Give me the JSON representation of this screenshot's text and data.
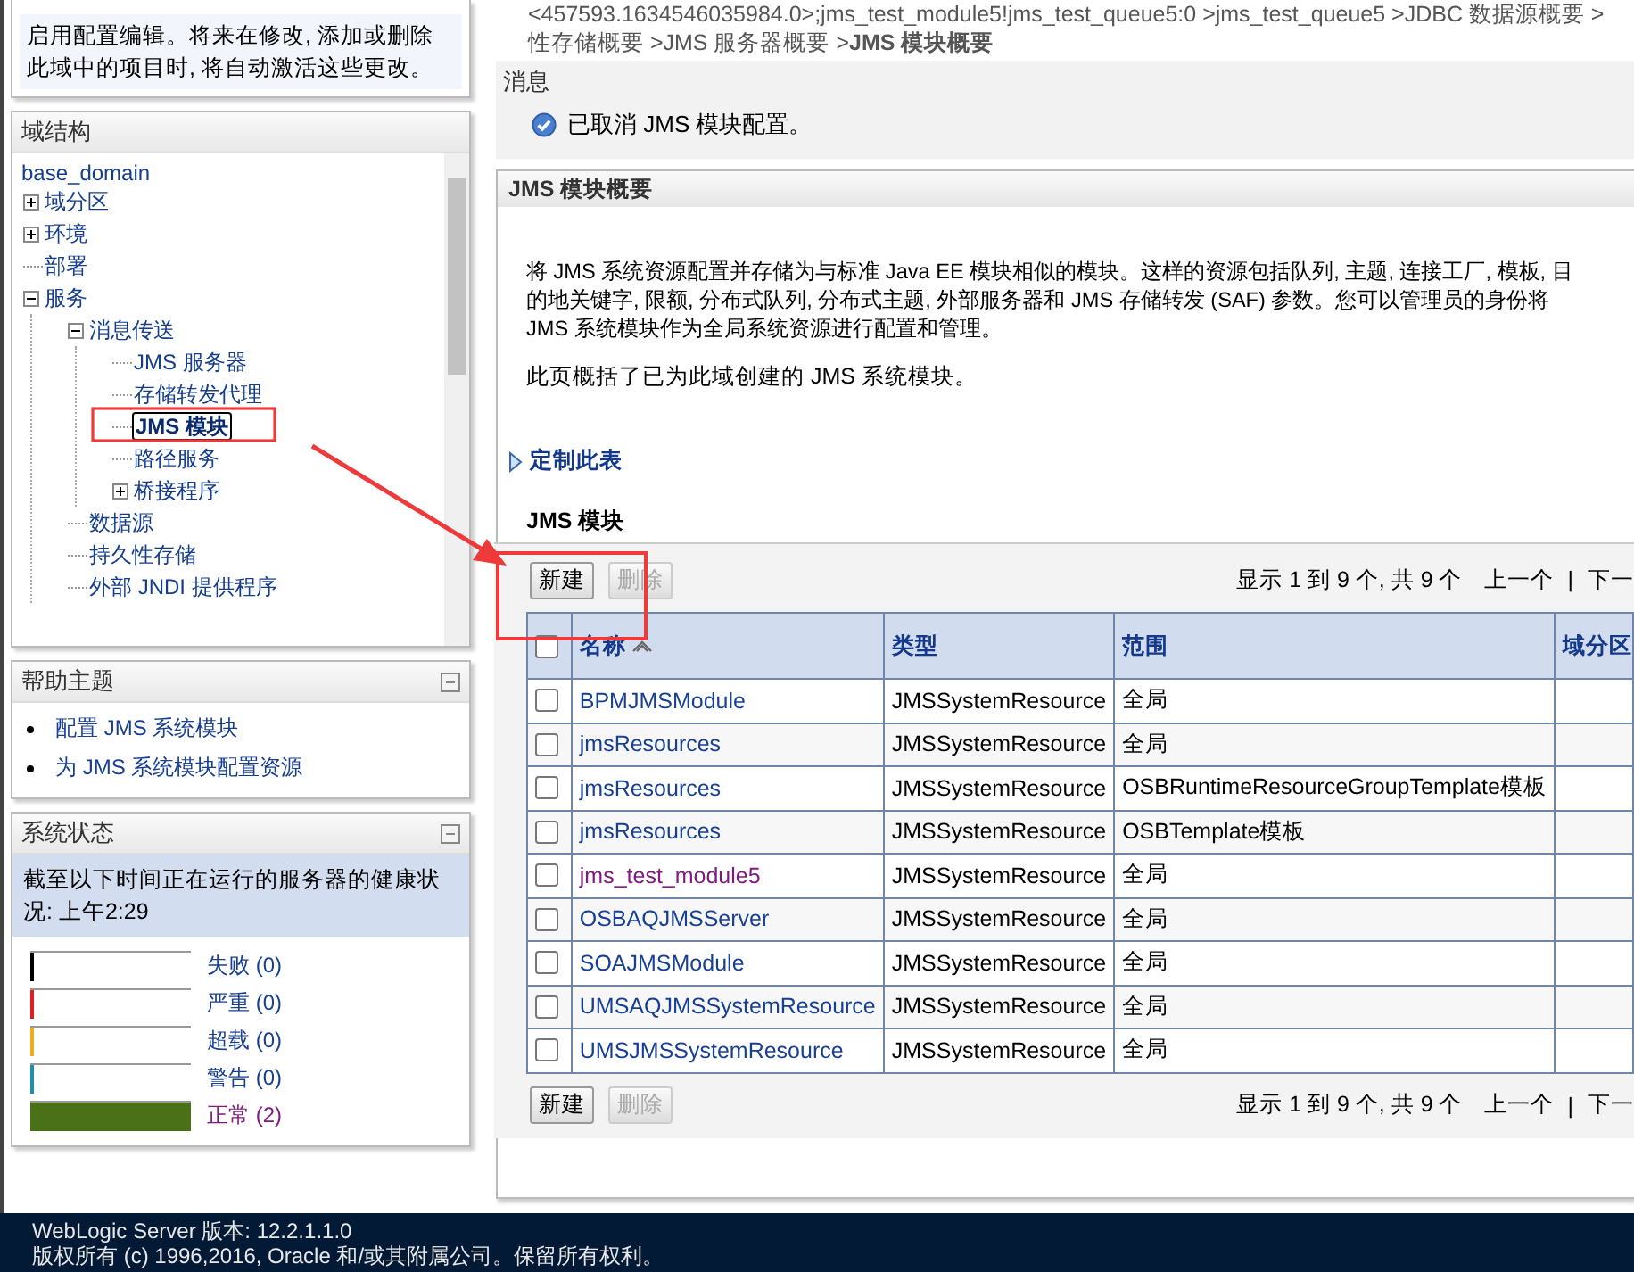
{
  "change_center": {
    "message": "启用配置编辑。将来在修改, 添加或删除此域中的项目时, 将自动激活这些更改。"
  },
  "domain_structure": {
    "title": "域结构",
    "root": "base_domain",
    "items": [
      {
        "label": "域分区",
        "selected": false,
        "expanded": false
      },
      {
        "label": "环境",
        "selected": false,
        "expanded": false
      },
      {
        "label": "部署",
        "selected": false
      },
      {
        "label": "服务",
        "selected": false,
        "expanded": true,
        "children": [
          {
            "label": "消息传送",
            "selected": false,
            "expanded": true,
            "children": [
              {
                "label": "JMS 服务器",
                "selected": false
              },
              {
                "label": "存储转发代理",
                "selected": false
              },
              {
                "label": "JMS 模块",
                "selected": true
              },
              {
                "label": "路径服务",
                "selected": false
              },
              {
                "label": "桥接程序",
                "selected": false,
                "expanded": false
              }
            ]
          },
          {
            "label": "数据源",
            "selected": false
          },
          {
            "label": "持久性存储",
            "selected": false
          },
          {
            "label": "外部 JNDI 提供程序",
            "selected": false
          }
        ]
      }
    ]
  },
  "help_topics": {
    "title": "帮助主题",
    "links": [
      "配置 JMS 系统模块",
      "为 JMS 系统模块配置资源"
    ]
  },
  "system_status": {
    "title": "系统状态",
    "summary": "截至以下时间正在运行的服务器的健康状况:  上午2:29",
    "items": [
      {
        "label": "失败 (0)",
        "color": "#000000",
        "level": 0,
        "visited": false
      },
      {
        "label": "严重 (0)",
        "color": "#e02020",
        "level": 0,
        "visited": false
      },
      {
        "label": "超载 (0)",
        "color": "#e8b020",
        "level": 0,
        "visited": false
      },
      {
        "label": "警告 (0)",
        "color": "#2090a8",
        "level": 0,
        "visited": false
      },
      {
        "label": "正常 (2)",
        "color": "#4a7018",
        "level": 1,
        "visited": true
      }
    ]
  },
  "breadcrumb": [
    "<457593.1634546035984.0>;jms_test_module5!jms_test_queue5:0 >jms_test_queue5 >JDBC 数据源概要 >",
    "性存储概要 >JMS 服务器概要 >**JMS 模块概要**"
  ],
  "messages": {
    "title": "消息",
    "items": [
      "已取消 JMS 模块配置。"
    ]
  },
  "panel": {
    "title": "JMS 模块概要",
    "description": [
      "将 JMS 系统资源配置并存储为与标准 Java EE 模块相似的模块。这样的资源包括队列, 主题, 连接工厂, 模板, 目",
      "的地关键字, 限额, 分布式队列, 分布式主题, 外部服务器和 JMS 存储转发 (SAF) 参数。您可以管理员的身份将",
      "JMS 系统模块作为全局系统资源进行配置和管理。"
    ],
    "summary": "此页概括了已为此域创建的 JMS 系统模块。",
    "customize_link": "定制此表",
    "table_title": "JMS 模块",
    "toolbars": [
      {
        "buttons": [
          {
            "label": "新建",
            "disabled": false
          },
          {
            "label": "删除",
            "disabled": true
          }
        ],
        "pager": {
          "text": "显示 1 到 9 个, 共 9 个",
          "prev": "上一个",
          "separator": "|",
          "next": "下一"
        }
      },
      {
        "buttons": [
          {
            "label": "新建",
            "disabled": false
          },
          {
            "label": "删除",
            "disabled": true
          }
        ],
        "pager": {
          "text": "显示 1 到 9 个, 共 9 个",
          "prev": "上一个",
          "separator": "|",
          "next": "下一"
        }
      }
    ],
    "select_all_checked": false,
    "columns": [
      {
        "label": "名称",
        "sorted": true
      },
      {
        "label": "类型",
        "sorted": false
      },
      {
        "label": "范围",
        "sorted": false
      },
      {
        "label": "域分区",
        "sorted": false
      }
    ],
    "rows": [
      {
        "name": "BPMJMSModule",
        "visited": false,
        "type": "JMSSystemResource",
        "scope": "全局",
        "checked": false
      },
      {
        "name": "jmsResources",
        "visited": false,
        "type": "JMSSystemResource",
        "scope": "全局",
        "checked": false
      },
      {
        "name": "jmsResources",
        "visited": false,
        "type": "JMSSystemResource",
        "scope": "OSBRuntimeResourceGroupTemplate模板",
        "checked": false
      },
      {
        "name": "jmsResources",
        "visited": false,
        "type": "JMSSystemResource",
        "scope": "OSBTemplate模板",
        "checked": false
      },
      {
        "name": "jms_test_module5",
        "visited": true,
        "type": "JMSSystemResource",
        "scope": "全局",
        "checked": false
      },
      {
        "name": "OSBAQJMSServer",
        "visited": false,
        "type": "JMSSystemResource",
        "scope": "全局",
        "checked": false
      },
      {
        "name": "SOAJMSModule",
        "visited": false,
        "type": "JMSSystemResource",
        "scope": "全局",
        "checked": false
      },
      {
        "name": "UMSAQJMSSystemResource",
        "visited": false,
        "type": "JMSSystemResource",
        "scope": "全局",
        "checked": false
      },
      {
        "name": "UMSJMSSystemResource",
        "visited": false,
        "type": "JMSSystemResource",
        "scope": "全局",
        "checked": false
      }
    ]
  },
  "footer": {
    "version": "WebLogic Server 版本: 12.2.1.1.0",
    "copyright": "版权所有 (c) 1996,2016, Oracle 和/或其附属公司。保留所有权利。"
  }
}
